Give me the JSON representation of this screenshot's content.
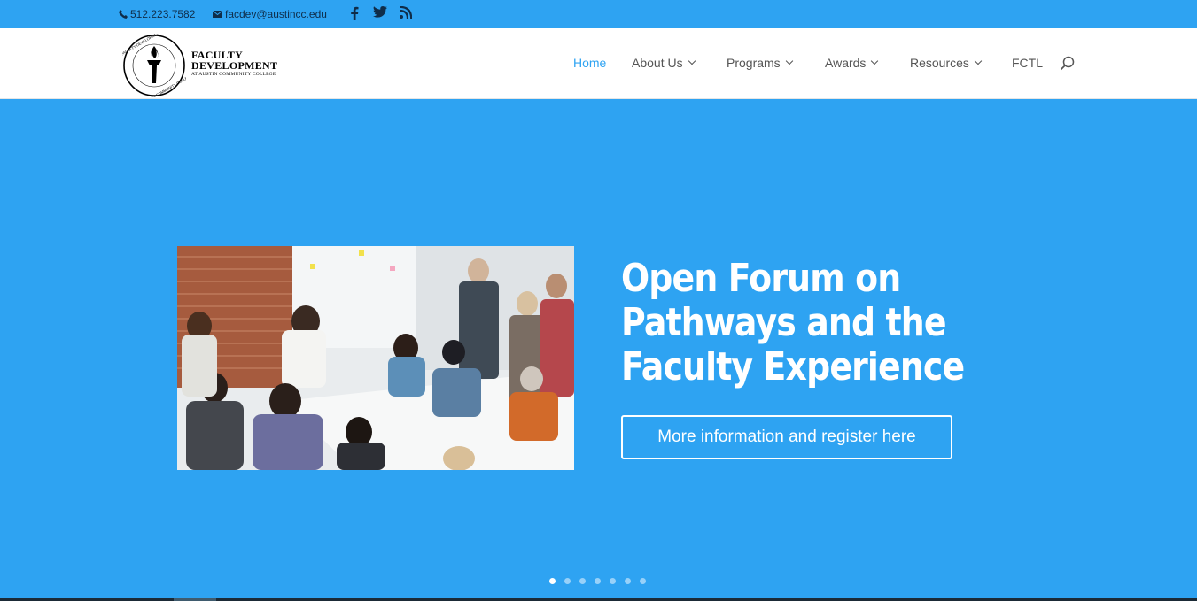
{
  "topbar": {
    "phone": "512.223.7582",
    "email": "facdev@austincc.edu",
    "social": [
      "facebook-icon",
      "twitter-icon",
      "rss-icon"
    ]
  },
  "logo": {
    "seal_text_top": "FACULTY DEVELOPMENT OFFICE",
    "seal_text_bottom": "AUSTIN COMMUNITY COLLEGE",
    "line1": "FACULTY",
    "line2": "DEVELOPMENT",
    "line3": "AT AUSTIN COMMUNITY COLLEGE"
  },
  "nav": {
    "items": [
      {
        "label": "Home",
        "active": true,
        "dropdown": false
      },
      {
        "label": "About Us",
        "active": false,
        "dropdown": true
      },
      {
        "label": "Programs",
        "active": false,
        "dropdown": true
      },
      {
        "label": "Awards",
        "active": false,
        "dropdown": true
      },
      {
        "label": "Resources",
        "active": false,
        "dropdown": true
      },
      {
        "label": "FCTL",
        "active": false,
        "dropdown": false
      }
    ]
  },
  "hero": {
    "headline_line1": "Open Forum on",
    "headline_line2": "Pathways and the",
    "headline_line3": "Faculty Experience",
    "cta_label": "More information and register here",
    "slide_count": 7,
    "active_slide": 1
  },
  "colors": {
    "accent": "#2ea3f2",
    "white": "#ffffff",
    "nav_text": "#555555"
  }
}
